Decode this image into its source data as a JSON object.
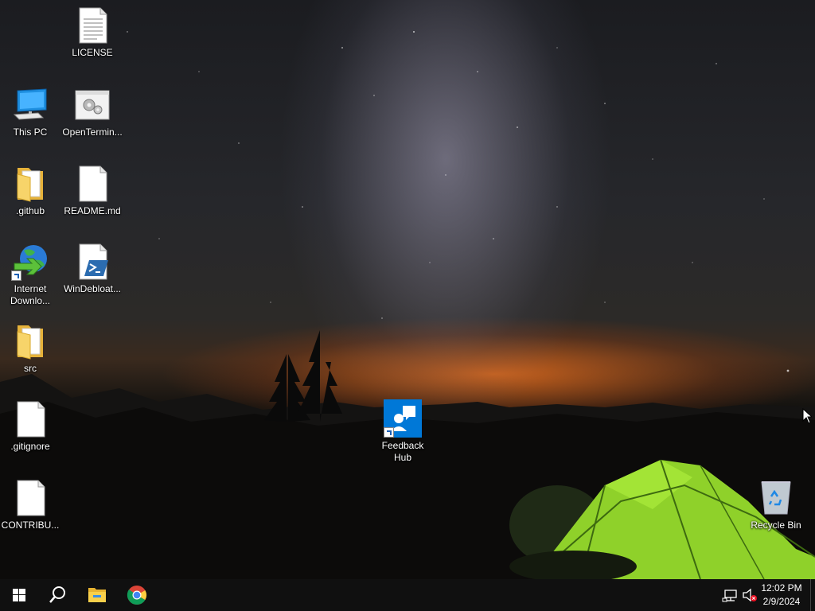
{
  "desktop": {
    "icons": [
      {
        "label": "LICENSE",
        "type": "text-file"
      },
      {
        "label": "This PC",
        "type": "computer"
      },
      {
        "label": "OpenTermin...",
        "type": "settings-file"
      },
      {
        "label": ".github",
        "type": "folder"
      },
      {
        "label": "README.md",
        "type": "blank-file"
      },
      {
        "label": "Internet Downlo...",
        "type": "internet-download-manager",
        "shortcut": true
      },
      {
        "label": "WinDebloat...",
        "type": "powershell-script"
      },
      {
        "label": "src",
        "type": "folder"
      },
      {
        "label": ".gitignore",
        "type": "blank-file"
      },
      {
        "label": "CONTRIBU...",
        "type": "blank-file"
      },
      {
        "label": "Feedback Hub",
        "type": "feedback-hub",
        "shortcut": true
      },
      {
        "label": "Recycle Bin",
        "type": "recycle-bin"
      }
    ]
  },
  "taskbar": {
    "buttons": [
      {
        "name": "start",
        "icon": "windows-logo-icon"
      },
      {
        "name": "search",
        "icon": "search-icon"
      },
      {
        "name": "file-explorer",
        "icon": "folder-icon"
      },
      {
        "name": "chrome",
        "icon": "chrome-icon"
      }
    ],
    "tray": {
      "network_icon": "network-icon",
      "volume_icon": "volume-muted-icon"
    },
    "clock": {
      "time": "12:02 PM",
      "date": "2/9/2024"
    }
  },
  "colors": {
    "taskbar_bg": "#101010",
    "windows_blue": "#0078d7",
    "folder_yellow": "#f4c542",
    "tent_green": "#8fd12a"
  }
}
